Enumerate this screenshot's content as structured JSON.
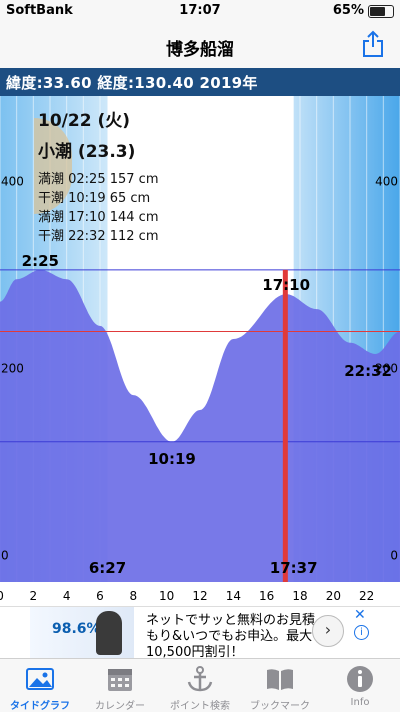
{
  "status_bar": {
    "carrier": "SoftBank",
    "time": "17:07",
    "battery": "65%"
  },
  "nav": {
    "title": "博多船溜"
  },
  "info_bar": {
    "text": "緯度:33.60 経度:130.40  2019年"
  },
  "day": {
    "date": "10/22 (火)",
    "tide_name": "小潮 (23.3)",
    "tides": [
      "満潮 02:25 157 cm",
      "干潮 10:19  65 cm",
      "満潮 17:10 144 cm",
      "干潮 22:32 112 cm"
    ]
  },
  "chart_data": {
    "type": "area",
    "title": "",
    "xlabel": "",
    "ylabel": "",
    "xlim": [
      0,
      24
    ],
    "ylim": [
      -10,
      250
    ],
    "x_ticks": [
      "0",
      "2",
      "4",
      "6",
      "8",
      "10",
      "12",
      "14",
      "16",
      "18",
      "20",
      "22"
    ],
    "y_ticks": [
      "0",
      "200",
      "400"
    ],
    "y_tick_values": [
      0,
      100,
      200
    ],
    "series": [
      {
        "x": [
          0,
          1,
          2.42,
          4,
          6,
          8,
          10.32,
          12,
          14,
          17.17,
          19,
          21,
          22.53,
          24
        ],
        "y": [
          140,
          152,
          157,
          152,
          127,
          90,
          65,
          82,
          120,
          144,
          136,
          118,
          112,
          124
        ]
      }
    ],
    "extremes": [
      {
        "label": "2:25",
        "x": 2.42,
        "y": 157
      },
      {
        "label": "10:19",
        "x": 10.32,
        "y": 65
      },
      {
        "label": "17:10",
        "x": 17.17,
        "y": 144
      },
      {
        "label": "22:32",
        "x": 22.53,
        "y": 112
      }
    ],
    "sunrise": {
      "label": "6:27",
      "x": 6.45
    },
    "sunset": {
      "label": "17:37",
      "x": 17.62
    },
    "current_time": 17.12,
    "current_level": 124,
    "colors": {
      "water": "#6c6ee6",
      "sky_light": "#d6ecfb",
      "sky": "#5fb2ec",
      "now_line": "#e03a3a"
    }
  },
  "ad": {
    "pct": "98.6%",
    "line1": "ネットでサッと無料のお見積",
    "line2": "もり&いつでもお申込。最大",
    "line3": "10,500円割引！",
    "close": "✕",
    "info": "i"
  },
  "tabs": [
    {
      "label": "タイドグラフ",
      "icon": "photo-icon"
    },
    {
      "label": "カレンダー",
      "icon": "calendar-icon"
    },
    {
      "label": "ポイント検索",
      "icon": "anchor-icon"
    },
    {
      "label": "ブックマーク",
      "icon": "book-icon"
    },
    {
      "label": "Info",
      "icon": "info-icon"
    }
  ]
}
